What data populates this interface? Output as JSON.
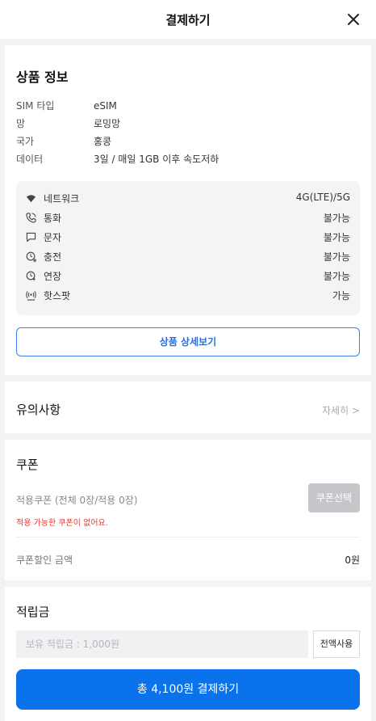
{
  "header": {
    "title": "결제하기"
  },
  "product": {
    "title": "상품 정보",
    "info": [
      {
        "key": "SIM 타입",
        "value": "eSIM"
      },
      {
        "key": "망",
        "value": "로밍망"
      },
      {
        "key": "국가",
        "value": "홍콩"
      },
      {
        "key": "데이터",
        "value": "3일 / 매일 1GB 이후 속도저하"
      }
    ],
    "specs": [
      {
        "label": "네트워크",
        "value": "4G(LTE)/5G",
        "icon": "wifi-icon"
      },
      {
        "label": "통화",
        "value": "불가능",
        "icon": "phone-icon"
      },
      {
        "label": "문자",
        "value": "불가능",
        "icon": "message-icon"
      },
      {
        "label": "충전",
        "value": "불가능",
        "icon": "recharge-icon"
      },
      {
        "label": "연장",
        "value": "불가능",
        "icon": "extend-icon"
      },
      {
        "label": "핫스팟",
        "value": "가능",
        "icon": "hotspot-icon"
      }
    ],
    "detail_button": "상품 상세보기"
  },
  "notice": {
    "title": "유의사항",
    "more": "자세히 >"
  },
  "coupon": {
    "title": "쿠폰",
    "applied": "적용쿠폰 (전체 0장/적용 0장)",
    "warning": "적용 가능한 쿠폰이 없어요.",
    "select_button": "쿠폰선택",
    "discount_label": "쿠폰할인 금액",
    "discount_value": "0원"
  },
  "points": {
    "title": "적립금",
    "placeholder": "보유 적립금 : 1,000원",
    "use_all_button": "전액사용"
  },
  "pay_button": "총 4,100원 결제하기",
  "colors": {
    "primary": "#0a73eb",
    "outline": "#3d7fe6",
    "warning": "#e53935",
    "disabled": "#c4c6ca"
  }
}
